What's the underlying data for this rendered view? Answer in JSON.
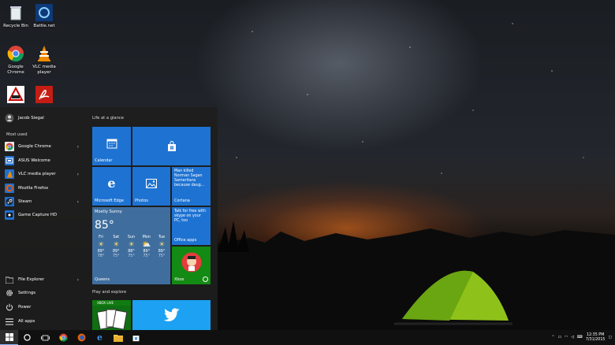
{
  "desktop": {
    "icons": [
      {
        "label": "Recycle Bin",
        "icon": "recycle-bin-icon"
      },
      {
        "label": "Battle.net",
        "icon": "battlenet-icon"
      },
      {
        "label": "Google Chrome",
        "icon": "chrome-icon"
      },
      {
        "label": "VLC media player",
        "icon": "vlc-icon"
      },
      {
        "label": "",
        "icon": "app-icon"
      },
      {
        "label": "",
        "icon": "acrobat-icon"
      }
    ]
  },
  "start_menu": {
    "user_name": "Jacob Siegal",
    "most_used_label": "Most used",
    "apps": [
      {
        "label": "Google Chrome",
        "has_arrow": true,
        "color": "#e8eaf0"
      },
      {
        "label": "ASUS Welcome",
        "has_arrow": false,
        "color": "#1f6fd1"
      },
      {
        "label": "VLC media player",
        "has_arrow": true,
        "color": "#1f6fd1"
      },
      {
        "label": "Mozilla Firefox",
        "has_arrow": false,
        "color": "#1f6fd1"
      },
      {
        "label": "Steam",
        "has_arrow": true,
        "color": "#1f6fd1"
      },
      {
        "label": "Game Capture HD",
        "has_arrow": false,
        "color": "#1f6fd1"
      }
    ],
    "bottom": [
      {
        "label": "File Explorer",
        "icon": "folder-icon",
        "has_arrow": true
      },
      {
        "label": "Settings",
        "icon": "gear-icon",
        "has_arrow": false
      },
      {
        "label": "Power",
        "icon": "power-icon",
        "has_arrow": false
      },
      {
        "label": "All apps",
        "icon": "list-icon",
        "has_arrow": false
      }
    ],
    "groups": {
      "life": "Life at a glance",
      "play": "Play and explore"
    },
    "tiles": {
      "calendar": "Calendar",
      "edge": "Microsoft Edge",
      "photos": "Photos",
      "cortana": "Cortana",
      "news_text": "Man killed Norman Sagan Samaritans because daug...",
      "office_text": "Talk for free with skype on your PC, too",
      "office": "Office apps",
      "xbox": "Xbox",
      "xbox_live": "XBOX LIVE"
    },
    "weather": {
      "title": "Mostly Sunny",
      "temp": "85°",
      "city": "Queens",
      "days": [
        {
          "day": "Fri",
          "high": "89°",
          "low": "78°"
        },
        {
          "day": "Sat",
          "high": "89°",
          "low": "75°"
        },
        {
          "day": "Sun",
          "high": "88°",
          "low": "75°"
        },
        {
          "day": "Mon",
          "high": "89°",
          "low": "75°"
        },
        {
          "day": "Tue",
          "high": "89°",
          "low": "75°"
        }
      ]
    }
  },
  "taskbar": {
    "time": "12:35 PM",
    "date": "7/31/2015"
  },
  "colors": {
    "tile_blue": "#1e73d2",
    "xbox_green": "#138a13",
    "accent": "#2b7fe0"
  }
}
